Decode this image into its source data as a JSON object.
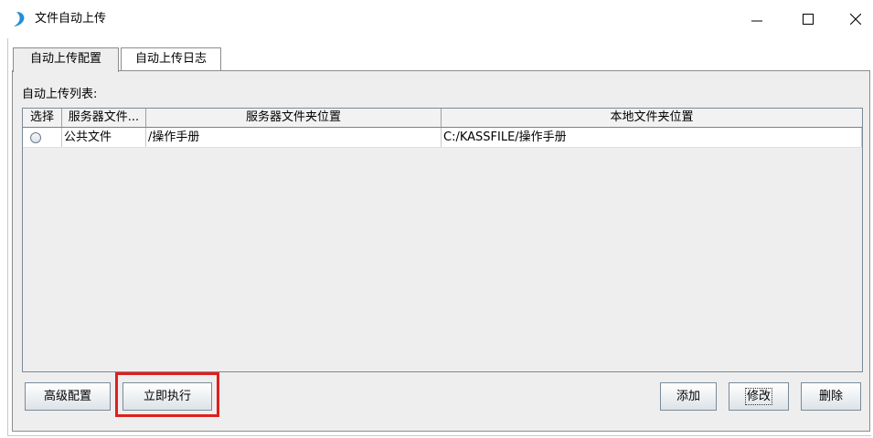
{
  "window": {
    "title": "文件自动上传",
    "icon": "app-swirl-icon",
    "controls": [
      "minimize-icon",
      "maximize-icon",
      "close-icon"
    ]
  },
  "tabs": [
    {
      "label": "自动上传配置",
      "active": true
    },
    {
      "label": "自动上传日志",
      "active": false
    }
  ],
  "list_label": "自动上传列表:",
  "table": {
    "headers": [
      "选择",
      "服务器文件...",
      "服务器文件夹位置",
      "本地文件夹位置"
    ],
    "rows": [
      {
        "selected": false,
        "server_file": "公共文件",
        "server_folder": "/操作手册",
        "local_folder": "C:/KASSFILE/操作手册"
      }
    ]
  },
  "buttons": {
    "advanced": "高级配置",
    "run_now": "立即执行",
    "add": "添加",
    "edit": "修改",
    "delete": "删除"
  },
  "colors": {
    "highlight": "#e01e1e",
    "icon_blue": "#1f8fd8",
    "panel_bg": "#eeeeee"
  }
}
